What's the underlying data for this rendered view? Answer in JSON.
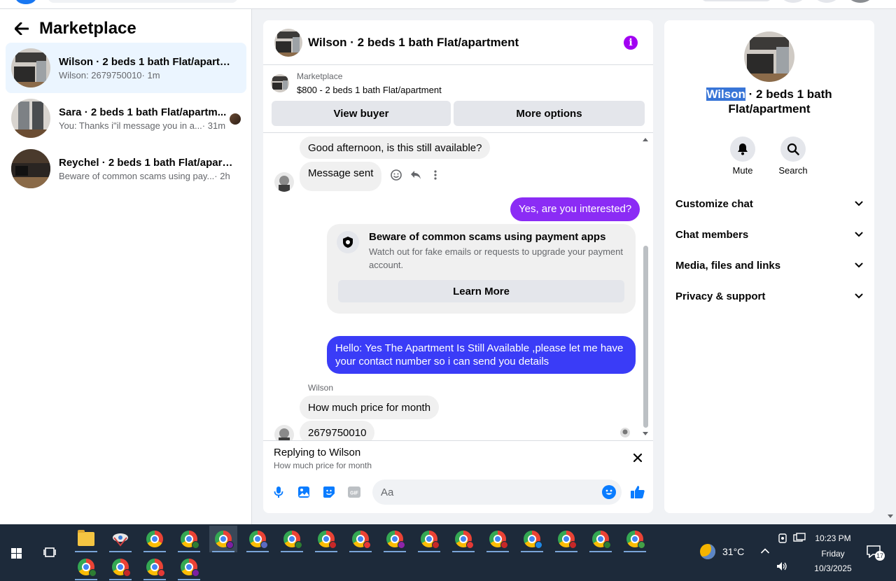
{
  "left": {
    "title": "Marketplace",
    "conversations": [
      {
        "name": "Wilson · 2 beds 1 bath Flat/apartm...",
        "preview": "Wilson: 2679750010",
        "time": " · 1m"
      },
      {
        "name": "Sara · 2 beds 1 bath Flat/apartm...",
        "preview": "You: Thanks i\"il message you in a...",
        "time": " · 31m"
      },
      {
        "name": "Reychel · 2 beds 1 bath Flat/apart...",
        "preview": "Beware of common scams using pay...",
        "time": " · 2h"
      }
    ]
  },
  "chat": {
    "title": "Wilson · 2 beds 1 bath Flat/apartment",
    "info_icon": "i",
    "listing": {
      "source": "Marketplace",
      "price_title": "$800 - 2 beds 1 bath Flat/apartment",
      "view_buyer": "View buyer",
      "more_options": "More options"
    },
    "messages": {
      "m1": "Good afternoon, is this still available?",
      "m2": "Message sent",
      "m3": "Yes, are you interested?",
      "scam_title": "Beware of common scams using payment apps",
      "scam_body": "Watch out for fake emails or requests to upgrade your payment account.",
      "learn_more": "Learn More",
      "m4": "Hello: Yes The Apartment Is Still Available ,please let me have your contact number so i can send you details",
      "sender": "Wilson",
      "m5": "How much price for month",
      "m6": "2679750010"
    },
    "replying": {
      "title": "Replying to Wilson",
      "quote": "How much price for month"
    },
    "composer": {
      "placeholder": "Aa",
      "gif_label": "GIF"
    }
  },
  "right": {
    "name_highlight": "Wilson",
    "name_rest": " · 2 beds 1 bath Flat/apartment",
    "actions": [
      {
        "label": "Mute",
        "icon": "bell-icon"
      },
      {
        "label": "Search",
        "icon": "search-icon"
      }
    ],
    "sections": [
      "Customize chat",
      "Chat members",
      "Media, files and links",
      "Privacy & support"
    ]
  },
  "taskbar": {
    "weather": "31°C",
    "time": "10:23 PM",
    "day": "Friday",
    "date": "10/3/2025",
    "notifications": "17"
  },
  "colors": {
    "accent": "#0a7cff",
    "purple_bubble": "#8b2cf5",
    "blue_bubble": "#3a3cf7",
    "info": "#a100f2",
    "taskbar": "#1d2a3a"
  }
}
